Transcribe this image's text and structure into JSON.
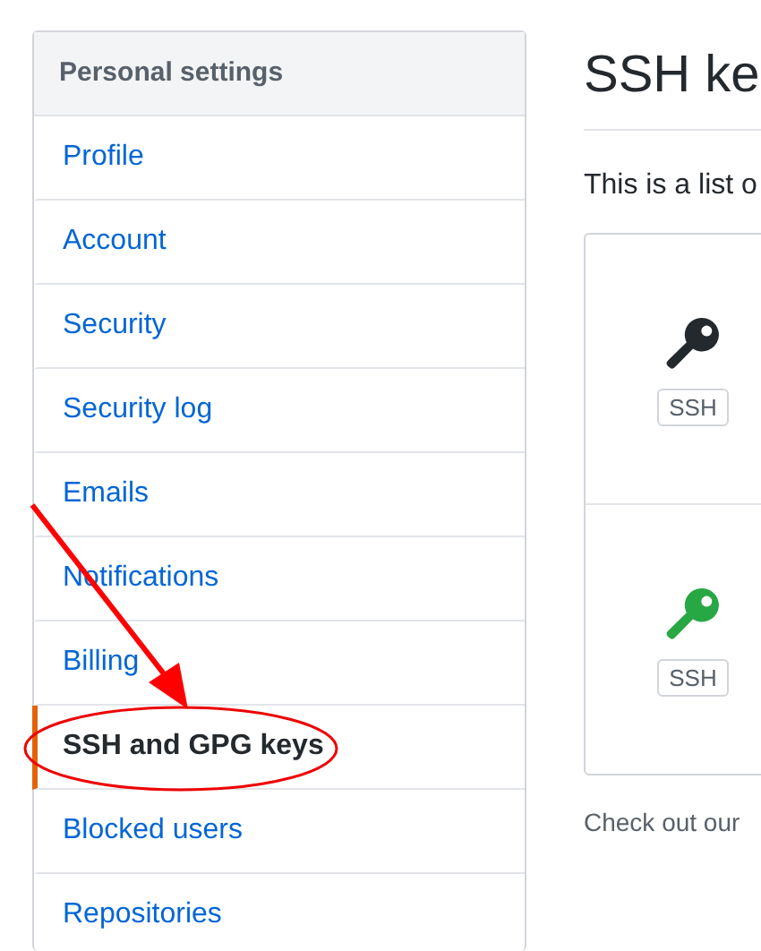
{
  "sidebar": {
    "title": "Personal settings",
    "items": [
      {
        "label": "Profile",
        "selected": false
      },
      {
        "label": "Account",
        "selected": false
      },
      {
        "label": "Security",
        "selected": false
      },
      {
        "label": "Security log",
        "selected": false
      },
      {
        "label": "Emails",
        "selected": false
      },
      {
        "label": "Notifications",
        "selected": false
      },
      {
        "label": "Billing",
        "selected": false
      },
      {
        "label": "SSH and GPG keys",
        "selected": true
      },
      {
        "label": "Blocked users",
        "selected": false
      },
      {
        "label": "Repositories",
        "selected": false
      }
    ]
  },
  "main": {
    "title": "SSH ke",
    "intro": "This is a list o",
    "keys": [
      {
        "color": "#24292e",
        "badge": "SSH"
      },
      {
        "color": "#28a745",
        "badge": "SSH"
      }
    ],
    "footer": "Check out our"
  }
}
